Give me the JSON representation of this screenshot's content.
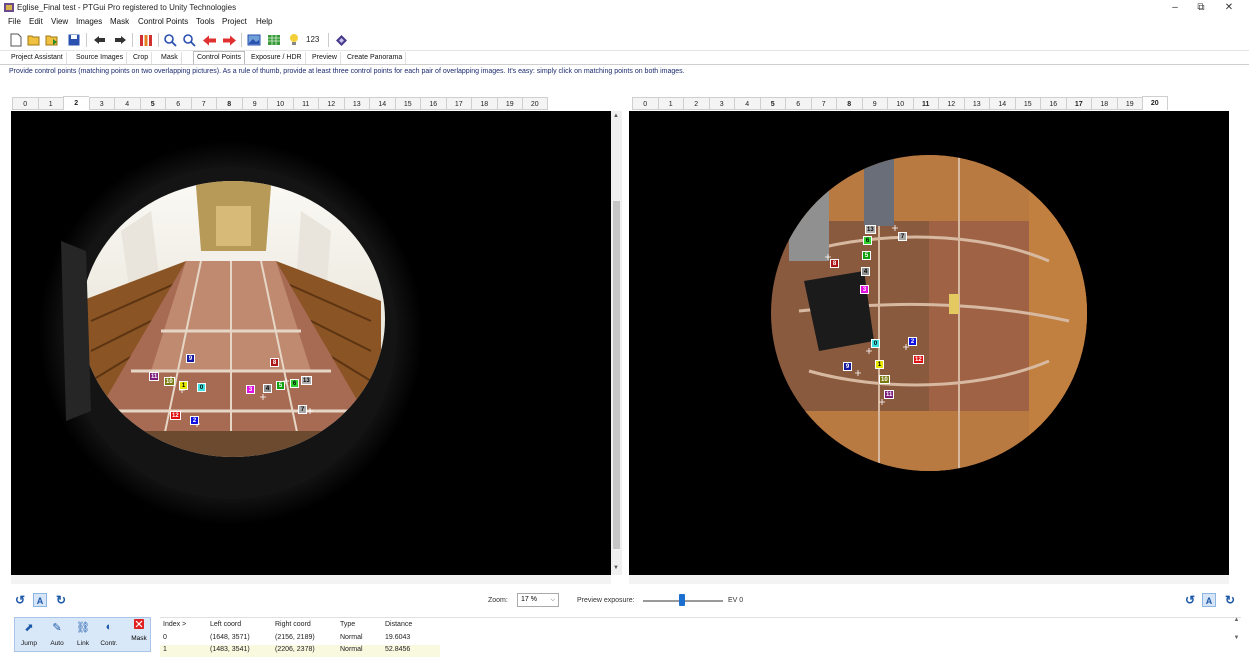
{
  "window": {
    "title": "Eglise_Final test - PTGui Pro registered to Unity Technologies",
    "minimize": "–",
    "restore": "⧉",
    "close": "✕"
  },
  "menu": [
    "File",
    "Edit",
    "View",
    "Images",
    "Mask",
    "Control Points",
    "Tools",
    "Project",
    "Help"
  ],
  "toolbar": {
    "counter_label": "123"
  },
  "main_tabs": [
    "Project Assistant",
    "Source Images",
    "Crop",
    "Mask",
    "Control Points",
    "Exposure / HDR",
    "Preview",
    "Create Panorama"
  ],
  "active_main_tab": "Control Points",
  "hint": "Provide control points (matching points on two overlapping pictures). As a rule of thumb, provide at least three control points for each pair of overlapping images. It's easy: simply click on matching points on both images.",
  "left_tabs": [
    "0",
    "1",
    "2",
    "3",
    "4",
    "5",
    "6",
    "7",
    "8",
    "9",
    "10",
    "11",
    "12",
    "13",
    "14",
    "15",
    "16",
    "17",
    "18",
    "19",
    "20"
  ],
  "left_active": "2",
  "right_tabs": [
    "0",
    "1",
    "2",
    "3",
    "4",
    "5",
    "6",
    "7",
    "8",
    "9",
    "10",
    "11",
    "12",
    "13",
    "14",
    "15",
    "16",
    "17",
    "18",
    "19",
    "20"
  ],
  "right_active": "20",
  "bottom": {
    "zoom_label": "Zoom:",
    "zoom_value": "17 %",
    "exposure_label": "Preview exposure:",
    "ev_label": "EV 0",
    "exposure_ev": 0
  },
  "cp_buttons": [
    "Jump",
    "Auto",
    "Link",
    "Contr.",
    "Mask"
  ],
  "cp_table": {
    "headers": [
      "Index >",
      "Left coord",
      "Right coord",
      "Type",
      "Distance"
    ],
    "rows": [
      [
        "0",
        "(1648, 3571)",
        "(2156, 2189)",
        "Normal",
        "19.6043"
      ],
      [
        "1",
        "(1483, 3541)",
        "(2206, 2378)",
        "Normal",
        "52.8456"
      ]
    ]
  },
  "control_points_left": [
    {
      "id": "9",
      "color": "#1a1aa0"
    },
    {
      "id": "8",
      "color": "#aa1515"
    },
    {
      "id": "11",
      "color": "#7a1a7a"
    },
    {
      "id": "10",
      "color": "#7a7a10"
    },
    {
      "id": "1",
      "color": "#e6e600"
    },
    {
      "id": "0",
      "color": "#40e0e0"
    },
    {
      "id": "3",
      "color": "#e010e0"
    },
    {
      "id": "4",
      "color": "#909090"
    },
    {
      "id": "5",
      "color": "#10a010"
    },
    {
      "id": "6",
      "color": "#30d030"
    },
    {
      "id": "13",
      "color": "#b0b0b0"
    },
    {
      "id": "7",
      "color": "#a8a8a8"
    },
    {
      "id": "12",
      "color": "#e01010"
    },
    {
      "id": "2",
      "color": "#1010e0"
    }
  ],
  "control_points_right": [
    {
      "id": "13",
      "color": "#b0b0b0"
    },
    {
      "id": "7",
      "color": "#a8a8a8"
    },
    {
      "id": "6",
      "color": "#30d030"
    },
    {
      "id": "5",
      "color": "#10a010"
    },
    {
      "id": "8",
      "color": "#aa1515"
    },
    {
      "id": "4",
      "color": "#909090"
    },
    {
      "id": "3",
      "color": "#e010e0"
    },
    {
      "id": "0",
      "color": "#40e0e0"
    },
    {
      "id": "2",
      "color": "#1010e0"
    },
    {
      "id": "12",
      "color": "#e01010"
    },
    {
      "id": "9",
      "color": "#1a1aa0"
    },
    {
      "id": "1",
      "color": "#e6e600"
    },
    {
      "id": "10",
      "color": "#7a7a10"
    },
    {
      "id": "11",
      "color": "#7a1a7a"
    }
  ]
}
